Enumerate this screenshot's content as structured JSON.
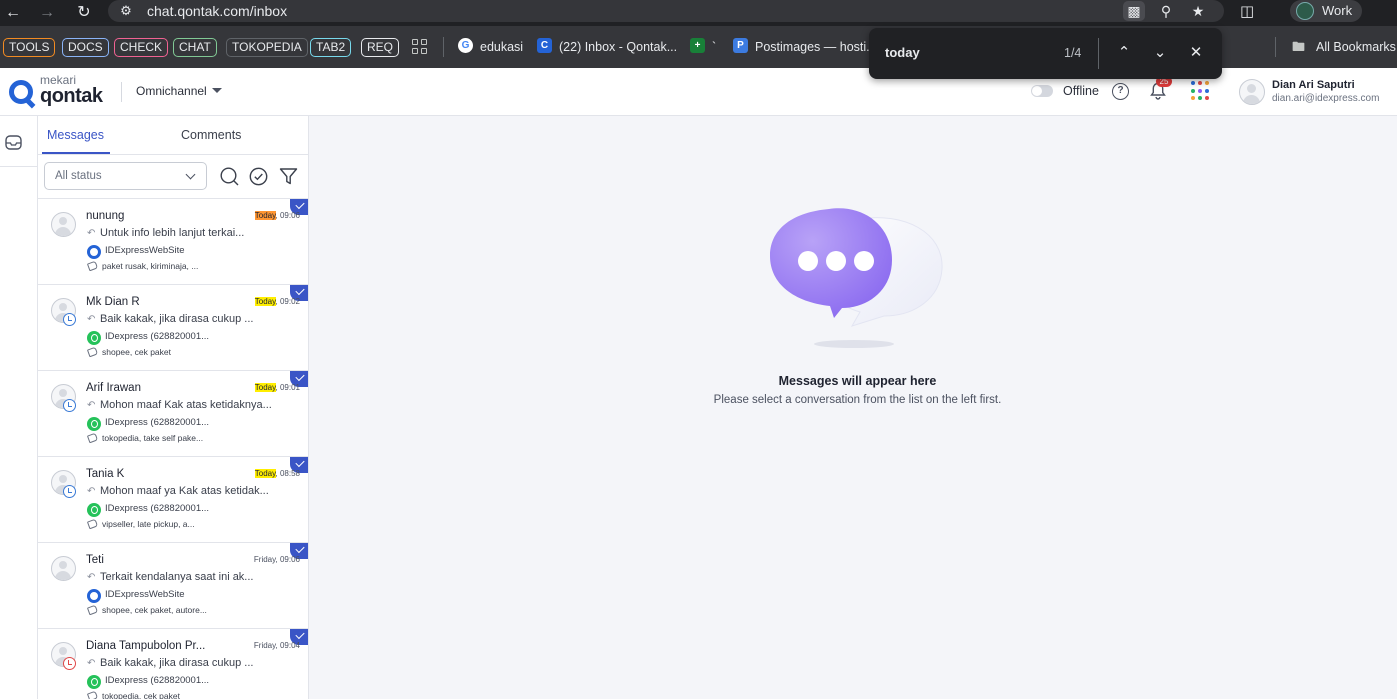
{
  "browser": {
    "url": "chat.qontak.com/inbox",
    "profile_name": "Work",
    "bookmarks": {
      "tags": [
        {
          "label": "TOOLS",
          "color": "#f28b22"
        },
        {
          "label": "DOCS",
          "color": "#8ab4f8"
        },
        {
          "label": "CHECK",
          "color": "#f06292"
        },
        {
          "label": "CHAT",
          "color": "#81c995"
        },
        {
          "label": "TOKOPEDIA",
          "color": "#5f6368"
        },
        {
          "label": "TAB2",
          "color": "#78d9ec"
        },
        {
          "label": "REQ",
          "color": "#e8eaed"
        }
      ],
      "links": [
        {
          "label": "edukasi",
          "icon": "google-icon"
        },
        {
          "label": "(22) Inbox - Qontak...",
          "icon": "qontak-icon"
        },
        {
          "label": "`",
          "icon": "sheets-icon"
        },
        {
          "label": "Postimages — hosti...",
          "icon": "postimages-icon"
        }
      ],
      "all_bookmarks": "All Bookmarks"
    },
    "find_bar": {
      "query": "today",
      "count": "1/4"
    }
  },
  "header": {
    "logo_small": "mekari",
    "logo_main": "qontak",
    "product": "Omnichannel",
    "status_label": "Offline",
    "notification_count": "25",
    "user_name": "Dian Ari Saputri",
    "user_email": "dian.ari@idexpress.com"
  },
  "sidebar": {
    "tabs": [
      {
        "label": "Messages",
        "active": true
      },
      {
        "label": "Comments",
        "active": false
      }
    ],
    "status_filter": "All status",
    "conversations": [
      {
        "name": "nunung",
        "time_highlight": "Today",
        "time_rest": ", 09:06",
        "highlight": "active",
        "preview": "Untuk info lebih lanjut terkai...",
        "channel": "IDExpressWebSite",
        "channel_type": "web",
        "tags": "paket rusak, kiriminaja, ...",
        "clock": "none"
      },
      {
        "name": "Mk Dian R",
        "time_highlight": "Today",
        "time_rest": ", 09:02",
        "highlight": "match",
        "preview": "Baik kakak, jika dirasa cukup ...",
        "channel": "IDexpress (628820001...",
        "channel_type": "wa",
        "tags": "shopee, cek paket",
        "clock": "blue"
      },
      {
        "name": "Arif Irawan",
        "time_highlight": "Today",
        "time_rest": ", 09:01",
        "highlight": "match",
        "preview": "Mohon maaf Kak atas ketidaknya...",
        "channel": "IDexpress (628820001...",
        "channel_type": "wa",
        "tags": "tokopedia, take self pake...",
        "clock": "blue"
      },
      {
        "name": "Tania K",
        "time_highlight": "Today",
        "time_rest": ", 08:58",
        "highlight": "match",
        "preview": "Mohon maaf ya Kak atas ketidak...",
        "channel": "IDexpress (628820001...",
        "channel_type": "wa",
        "tags": "vipseller, late pickup, a...",
        "clock": "blue"
      },
      {
        "name": "Teti",
        "time_highlight": "",
        "time_rest": "Friday, 09:06",
        "highlight": "none",
        "preview": "Terkait kendalanya saat ini ak...",
        "channel": "IDExpressWebSite",
        "channel_type": "web",
        "tags": "shopee, cek paket, autore...",
        "clock": "none"
      },
      {
        "name": "Diana Tampubolon Pr...",
        "time_highlight": "",
        "time_rest": "Friday, 09:04",
        "highlight": "none",
        "preview": "Baik kakak, jika dirasa cukup ...",
        "channel": "IDexpress (628820001...",
        "channel_type": "wa",
        "tags": "tokopedia, cek paket",
        "clock": "red"
      }
    ]
  },
  "main": {
    "empty_title": "Messages will appear here",
    "empty_subtitle": "Please select a conversation from the list on the left first."
  },
  "colors": {
    "accent": "#3a55c6",
    "logo_blue": "#2463d6",
    "find_active": "#ff9632",
    "find_match": "#ffee00"
  }
}
